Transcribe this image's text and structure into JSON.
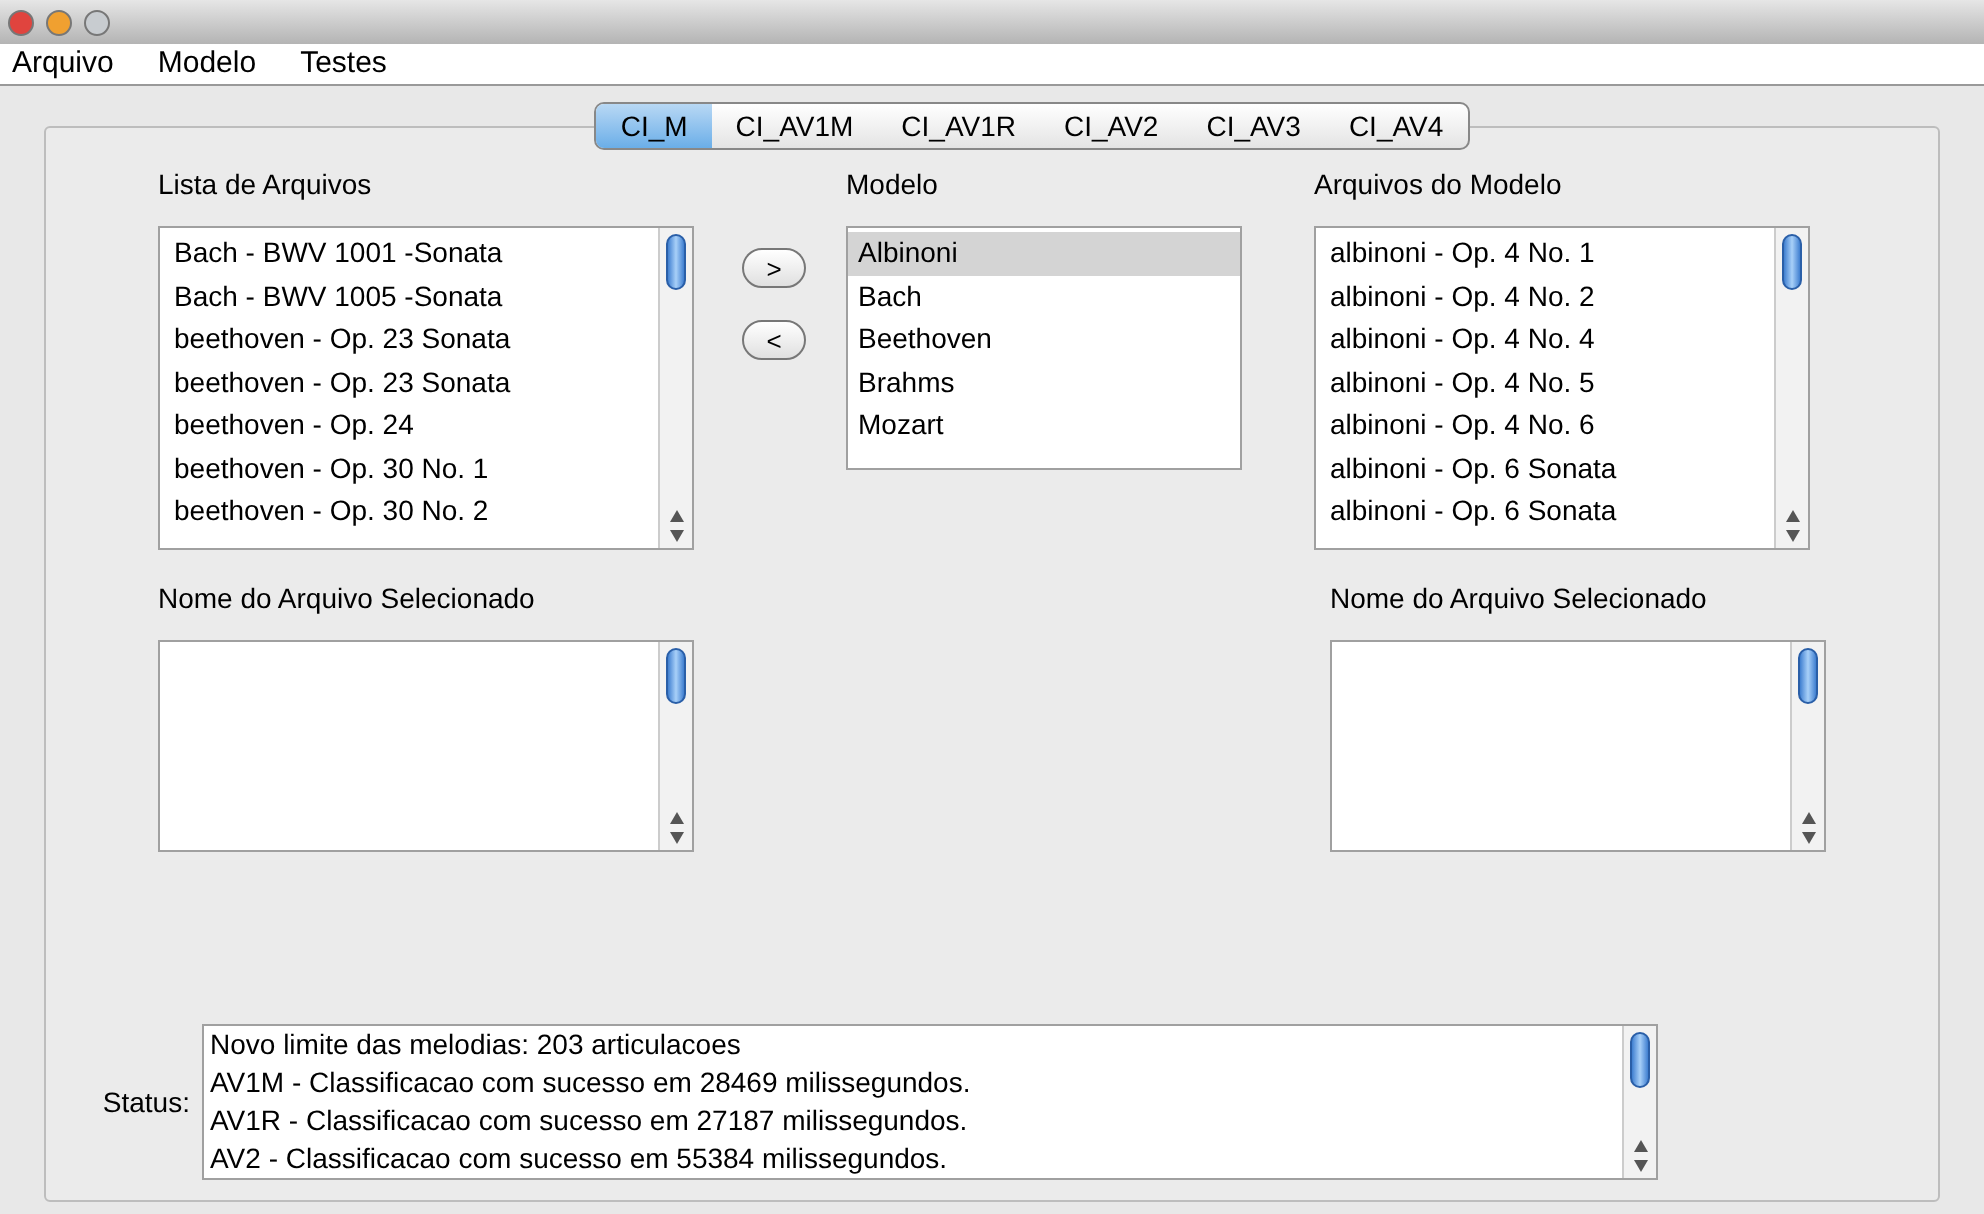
{
  "window": {
    "buttons": [
      {
        "kind": "close"
      },
      {
        "kind": "minimize"
      },
      {
        "kind": "zoom"
      }
    ]
  },
  "menu": [
    "Arquivo",
    "Modelo",
    "Testes"
  ],
  "tabs": [
    {
      "label": "CI_M",
      "selected": true
    },
    {
      "label": "CI_AV1M",
      "selected": false
    },
    {
      "label": "CI_AV1R",
      "selected": false
    },
    {
      "label": "CI_AV2",
      "selected": false
    },
    {
      "label": "CI_AV3",
      "selected": false
    },
    {
      "label": "CI_AV4",
      "selected": false
    }
  ],
  "file_list": {
    "label": "Lista de Arquivos",
    "items": [
      "Bach - BWV 1001 -Sonata",
      "Bach - BWV 1005 -Sonata",
      "beethoven - Op. 23 Sonata",
      "beethoven - Op. 23 Sonata",
      "beethoven - Op. 24",
      "beethoven - Op. 30 No. 1",
      "beethoven - Op. 30 No. 2"
    ]
  },
  "move_buttons": [
    ">",
    "<"
  ],
  "model_list": {
    "label": "Modelo",
    "items": [
      {
        "text": "Albinoni",
        "selected": true
      },
      {
        "text": "Bach",
        "selected": false
      },
      {
        "text": "Beethoven",
        "selected": false
      },
      {
        "text": "Brahms",
        "selected": false
      },
      {
        "text": "Mozart",
        "selected": false
      }
    ]
  },
  "model_files": {
    "label": "Arquivos do Modelo",
    "items": [
      "albinoni - Op. 4 No. 1",
      "albinoni - Op. 4 No. 2",
      "albinoni - Op. 4 No. 4",
      "albinoni - Op. 4 No. 5",
      "albinoni - Op. 4 No. 6",
      "albinoni - Op. 6 Sonata",
      "albinoni - Op. 6 Sonata"
    ]
  },
  "selected_name_left": {
    "label": "Nome do Arquivo Selecionado"
  },
  "selected_name_right": {
    "label": "Nome do Arquivo Selecionado"
  },
  "status": {
    "label": "Status:",
    "lines": [
      "Novo limite das melodias: 203 articulacoes",
      "AV1M - Classificacao com sucesso em 28469 milissegundos.",
      "AV1R - Classificacao com sucesso em 27187 milissegundos.",
      "AV2 - Classificacao com sucesso em 55384 milissegundos."
    ]
  }
}
